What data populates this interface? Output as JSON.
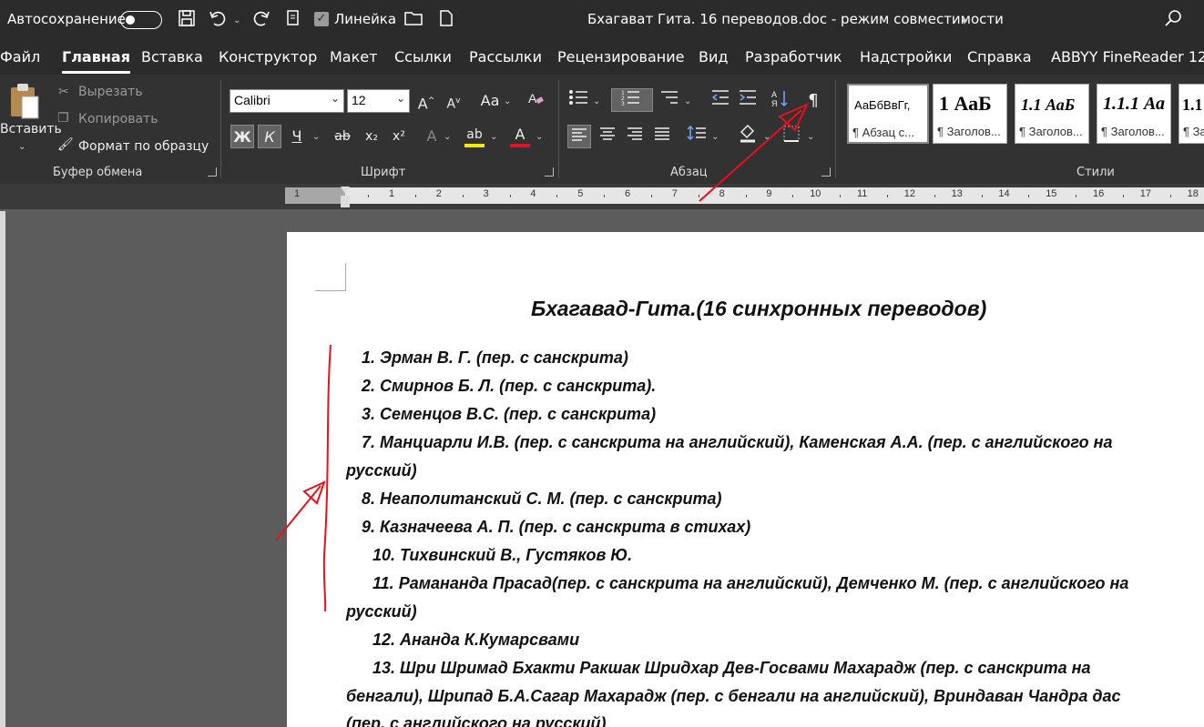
{
  "titlebar": {
    "autosave_label": "Автосохранение",
    "ruler_label": "Линейка",
    "document_title": "Бхагават Гита. 16 переводов.doc  -  режим совместимости",
    "icons": [
      "save-icon",
      "undo-icon",
      "redo-icon",
      "checkbox-icon",
      "folder-icon",
      "new-document-icon",
      "search-icon"
    ]
  },
  "tabs": [
    "Файл",
    "Главная",
    "Вставка",
    "Конструктор",
    "Макет",
    "Ссылки",
    "Рассылки",
    "Рецензирование",
    "Вид",
    "Разработчик",
    "Надстройки",
    "Справка",
    "ABBYY FineReader 12"
  ],
  "active_tab": "Главная",
  "clipboard": {
    "paste_label": "Вставить",
    "cut_label": "Вырезать",
    "copy_label": "Копировать",
    "format_painter_label": "Формат по образцу",
    "group_label": "Буфер обмена"
  },
  "font": {
    "name": "Calibri",
    "size": "12",
    "bold": "Ж",
    "italic": "К",
    "underline": "Ч",
    "strike": "ab",
    "subscript": "x₂",
    "superscript": "x²",
    "grow": "A",
    "shrink": "A",
    "case": "Aa",
    "effects": "A",
    "highlight": "ab",
    "color": "A",
    "group_label": "Шрифт"
  },
  "paragraph": {
    "pilcrow": "¶",
    "group_label": "Абзац"
  },
  "styles": {
    "group_label": "Стили",
    "items": [
      {
        "sample": "АаБбВвГг,",
        "name": "¶ Абзац с..."
      },
      {
        "sample": "1  АаБ",
        "name": "¶ Заголов..."
      },
      {
        "sample": "1.1  АаБ",
        "name": "¶ Заголов..."
      },
      {
        "sample": "1.1.1  Аа",
        "name": "¶ Заголов..."
      },
      {
        "sample": "1.1",
        "name": "¶ Заг"
      }
    ]
  },
  "ruler": {
    "left_number": "1",
    "numbers": [
      "1",
      "2",
      "3",
      "4",
      "5",
      "6",
      "7",
      "8",
      "9",
      "10",
      "11",
      "12",
      "13",
      "14",
      "15",
      "16",
      "17",
      "18"
    ]
  },
  "document": {
    "title": "Бхагавад-Гита.(16 синхронных переводов)",
    "lines": [
      "1. Эрман В. Г. (пер. с санскрита)",
      "2. Смирнов Б. Л. (пер. с санскрита).",
      "3. Семенцов В.С. (пер. с санскрита)",
      "7. Манциарли И.В. (пер. с санскрита на английский),  Каменская А.А. (пер. с английского  на",
      "русский)",
      "8. Неаполитанский С. М. (пер. с санскрита)",
      "9. Казначеева А. П.  (пер. с санскрита в стихах)",
      "10. Тихвинский В., Густяков Ю.",
      "11. Рамананда Прасад(пер. с санскрита на английский), Демченко М. (пер. с английского  на",
      "русский)",
      "12. Ананда К.Кумарсвами",
      "13. Шри Шримад Бхакти Ракшак Шридхар Дев-Госвами Махарадж (пер. с санскрита на",
      "бенгали), Шрипад Б.А.Сагар Махарадж (пер. с бенгали на английский), Вриндаван Чандра дас",
      "(пер. с английского  на русский)"
    ]
  },
  "annotation_color": "#e8101a"
}
